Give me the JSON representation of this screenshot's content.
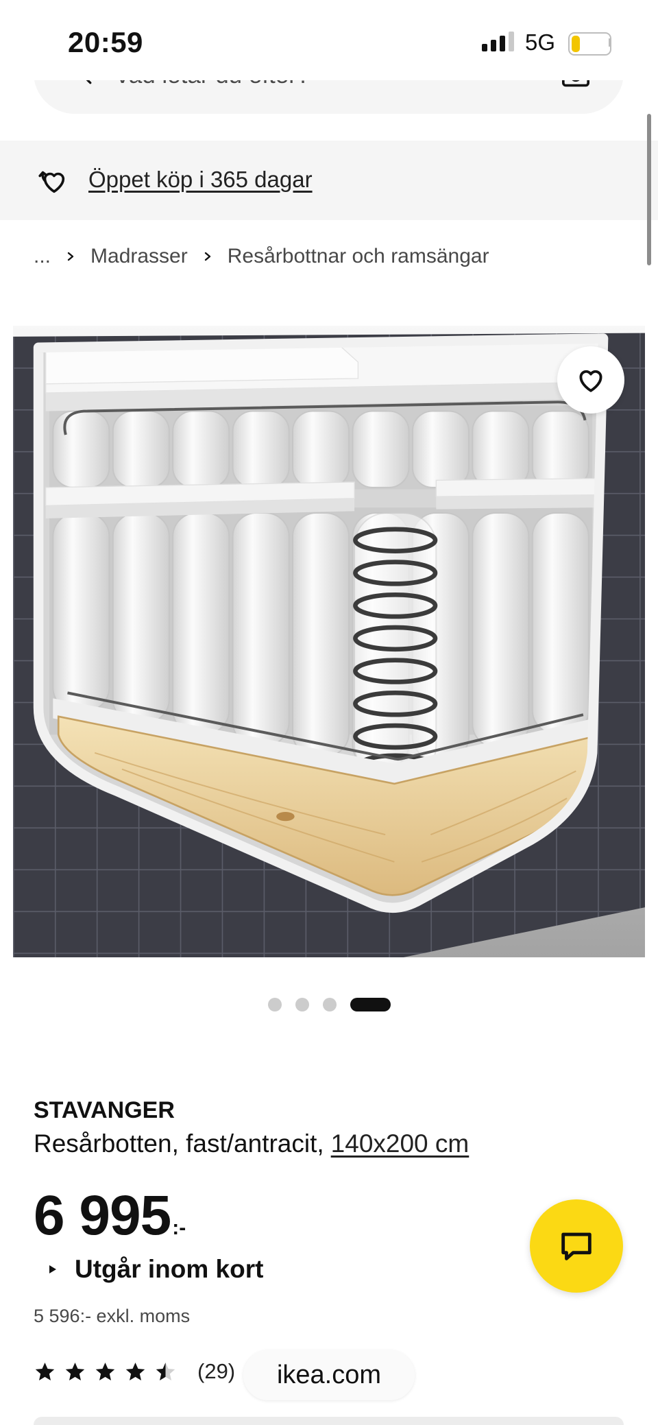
{
  "status_bar": {
    "time": "20:59",
    "network": "5G",
    "signal_bars": 3,
    "signal_max": 4,
    "battery_level": 0.22
  },
  "search": {
    "placeholder": "Vad letar du efter?",
    "search_icon": "search-icon",
    "camera_icon": "camera-icon"
  },
  "banner": {
    "text": "Öppet köp i 365 dagar",
    "icon": "return-policy-icon"
  },
  "breadcrumb": {
    "items": [
      "...",
      "Madrasser",
      "Resårbottnar och ramsängar"
    ],
    "separator_icon": "chevron-right-icon"
  },
  "gallery": {
    "image_count": 4,
    "active_index": 3,
    "favorite_icon": "heart-icon"
  },
  "product": {
    "name": "STAVANGER",
    "description": "Resårbotten, fast/antracit,",
    "size_link": "140x200 cm",
    "price": "6 995",
    "price_suffix": ":-",
    "stock_status": "Utgår inom kort",
    "price_excl_vat": "5 596:- exkl. moms",
    "rating": 4.5,
    "rating_max": 5,
    "review_count": "(29)"
  },
  "chat": {
    "icon": "chat-icon"
  },
  "browser": {
    "url": "ikea.com"
  },
  "colors": {
    "accent": "#fbd914",
    "banner_bg": "#f5f5f5",
    "text": "#111111",
    "muted_text": "#484848",
    "dot_inactive": "#cccccc",
    "dot_active": "#111111",
    "battery": "#f2c500",
    "star_empty": "#d0d0d0"
  }
}
